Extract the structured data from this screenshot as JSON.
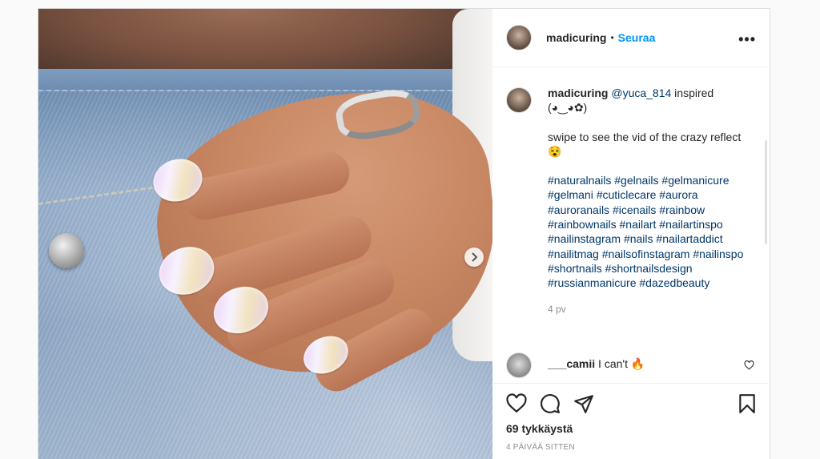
{
  "post": {
    "next_icon": "chevron-right-icon"
  },
  "header": {
    "username": "madicuring",
    "separator": "•",
    "follow_label": "Seuraa",
    "more_label": "•••"
  },
  "caption": {
    "username": "madicuring",
    "mention": "@yuca_814",
    "first_line_rest": " inspired (◕‿◕✿)",
    "line2": "swipe to see the vid of the crazy reflect 😵",
    "hashtags": "#naturalnails #gelnails #gelmanicure #gelmani #cuticlecare #aurora #auroranails #icenails #rainbow #rainbownails #nailart #nailartinspo #nailinstagram #nails #nailartaddict #nailitmag #nailsofinstagram #nailinspo #shortnails #shortnailsdesign #russianmanicure #dazedbeauty",
    "age": "4 pv"
  },
  "comment": {
    "username": "___camii",
    "text": " I can't 🔥",
    "like_icon": "heart-outline-icon"
  },
  "actions": {
    "likes": "69 tykkäystä",
    "date": "4 PÄIVÄÄ SITTEN",
    "icons": [
      "heart-icon",
      "comment-icon",
      "share-icon",
      "bookmark-icon"
    ]
  }
}
